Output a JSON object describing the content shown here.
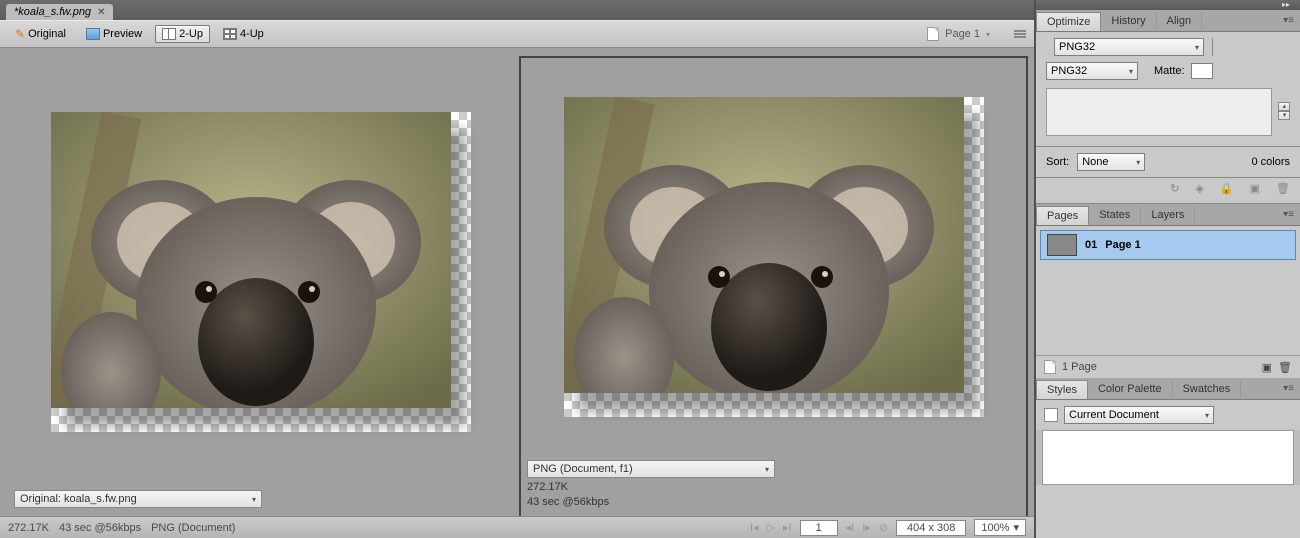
{
  "document": {
    "tab_title": "*koala_s.fw.png"
  },
  "toolbar": {
    "original": "Original",
    "preview": "Preview",
    "two_up": "2-Up",
    "four_up": "4-Up",
    "page_label": "Page 1"
  },
  "left_panel": {
    "dropdown": "Original: koala_s.fw.png"
  },
  "right_panel": {
    "dropdown": "PNG (Document, f1)",
    "size": "272.17K",
    "time": "43 sec @56kbps"
  },
  "status": {
    "size": "272.17K",
    "time": "43 sec @56kbps",
    "mode": "PNG (Document)",
    "frame": "1",
    "dimensions": "404 x 308",
    "zoom": "100%"
  },
  "optimize": {
    "tabs": {
      "optimize": "Optimize",
      "history": "History",
      "align": "Align"
    },
    "preset": "PNG32",
    "format": "PNG32",
    "matte_label": "Matte:",
    "sort_label": "Sort:",
    "sort_value": "None",
    "colors_label": "0 colors"
  },
  "pages": {
    "tabs": {
      "pages": "Pages",
      "states": "States",
      "layers": "Layers"
    },
    "item": {
      "num": "01",
      "name": "Page 1"
    },
    "footer": "1 Page"
  },
  "styles": {
    "tabs": {
      "styles": "Styles",
      "palette": "Color Palette",
      "swatches": "Swatches"
    },
    "scope": "Current Document"
  }
}
